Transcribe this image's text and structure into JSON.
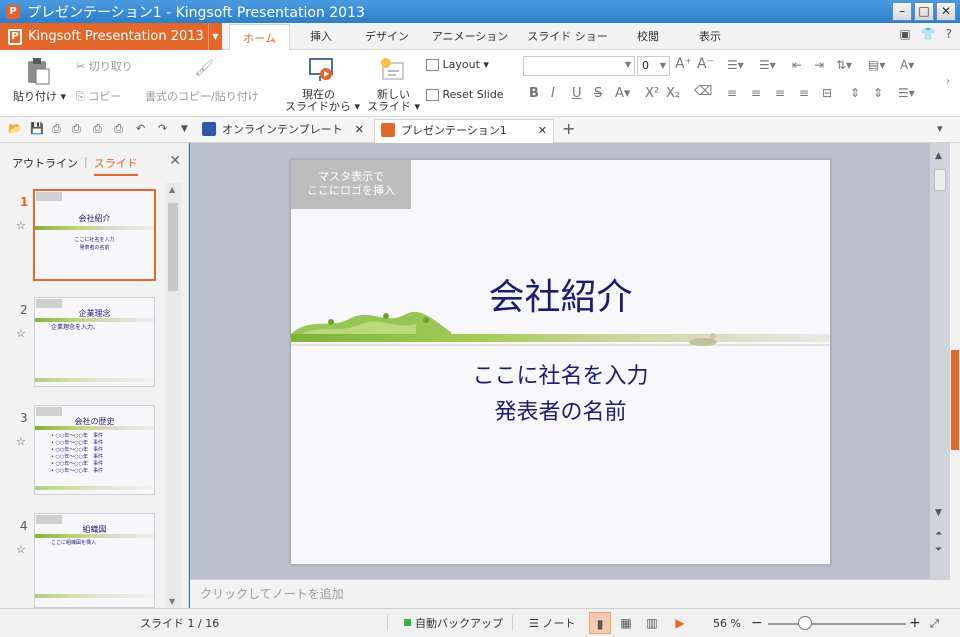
{
  "window": {
    "title": "プレゼンテーション1 - Kingsoft Presentation 2013"
  },
  "app_menu": {
    "label": "Kingsoft Presentation 2013"
  },
  "tabs": [
    {
      "label": "ホーム"
    },
    {
      "label": "挿入"
    },
    {
      "label": "デザイン"
    },
    {
      "label": "アニメーション"
    },
    {
      "label": "スライド ショー"
    },
    {
      "label": "校閲"
    },
    {
      "label": "表示"
    }
  ],
  "tab_right_icons": {
    "help": "?"
  },
  "ribbon": {
    "paste": "貼り付け",
    "cut": "切り取り",
    "copy": "コピー",
    "format_painter": "書式のコピー/貼り付け",
    "from_current_1": "現在の",
    "from_current_2": "スライドから",
    "new_slide_1": "新しい",
    "new_slide_2": "スライド",
    "layout": "Layout",
    "reset_slide": "Reset Slide",
    "font_size": "0"
  },
  "doc_tabs": [
    {
      "label": "オンラインテンプレート"
    },
    {
      "label": "プレゼンテーション1"
    }
  ],
  "left_panel": {
    "tab_outline": "アウトライン",
    "tab_slides": "スライド",
    "slides": [
      {
        "num": "1",
        "title": "会社紹介",
        "line1": "ここに社名を入力",
        "line2": "発表者の名前"
      },
      {
        "num": "2",
        "title": "企業理念",
        "body": "企業理念を入力。"
      },
      {
        "num": "3",
        "title": "会社の歴史",
        "body": "• ○○年～○○年　事件\n• ○○年～○○年　事件\n• ○○年～○○年　事件\n• ○○年～○○年　事件\n• ○○年～○○年　事件\n• ○○年～○○年　事件"
      },
      {
        "num": "4",
        "title": "組織図",
        "body": "ここに組織図を挿入"
      }
    ]
  },
  "slide": {
    "master_note_1": "マスタ表示で",
    "master_note_2": "ここにロゴを挿入",
    "title": "会社紹介",
    "subtitle_1": "ここに社名を入力",
    "subtitle_2": "発表者の名前"
  },
  "notes": {
    "placeholder": "クリックしてノートを追加"
  },
  "status": {
    "slide_counter": "スライド 1 / 16",
    "autobackup": "自動バックアップ",
    "notes_toggle": "ノート",
    "zoom": "56 %"
  },
  "colors": {
    "accent": "#e2672b",
    "titlebar": "#2d7fcb",
    "slide_text": "#1c1c70"
  }
}
